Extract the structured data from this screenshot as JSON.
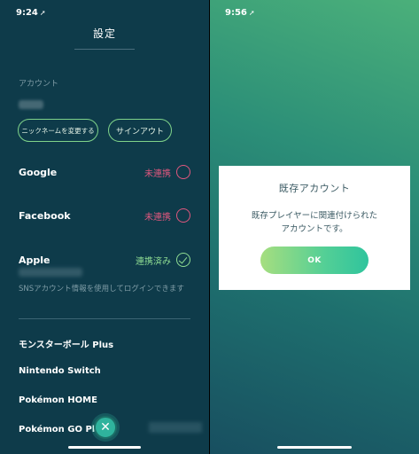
{
  "left": {
    "status": {
      "time": "9:24"
    },
    "title": "設定",
    "account_label": "アカウント",
    "buttons": {
      "nickname": "ニックネームを変更する",
      "signout": "サインアウト"
    },
    "links": [
      {
        "name": "Google",
        "status": "未連携",
        "linked": false
      },
      {
        "name": "Facebook",
        "status": "未連携",
        "linked": false
      },
      {
        "name": "Apple",
        "status": "連携済み",
        "linked": true
      }
    ],
    "sns_note": "SNSアカウント情報を使用してログインできます",
    "services": [
      "モンスターボール Plus",
      "Nintendo Switch",
      "Pokémon HOME",
      "Pokémon GO Plus"
    ],
    "close_symbol": "✕"
  },
  "right": {
    "status": {
      "time": "9:56"
    },
    "dialog": {
      "title": "既存アカウント",
      "body_line1": "既存プレイヤーに関連付けられた",
      "body_line2": "アカウントです。",
      "ok": "OK"
    }
  },
  "colors": {
    "unlinked": "#e0577e",
    "linked": "#8fdd93",
    "accent": "#2fc49d"
  }
}
